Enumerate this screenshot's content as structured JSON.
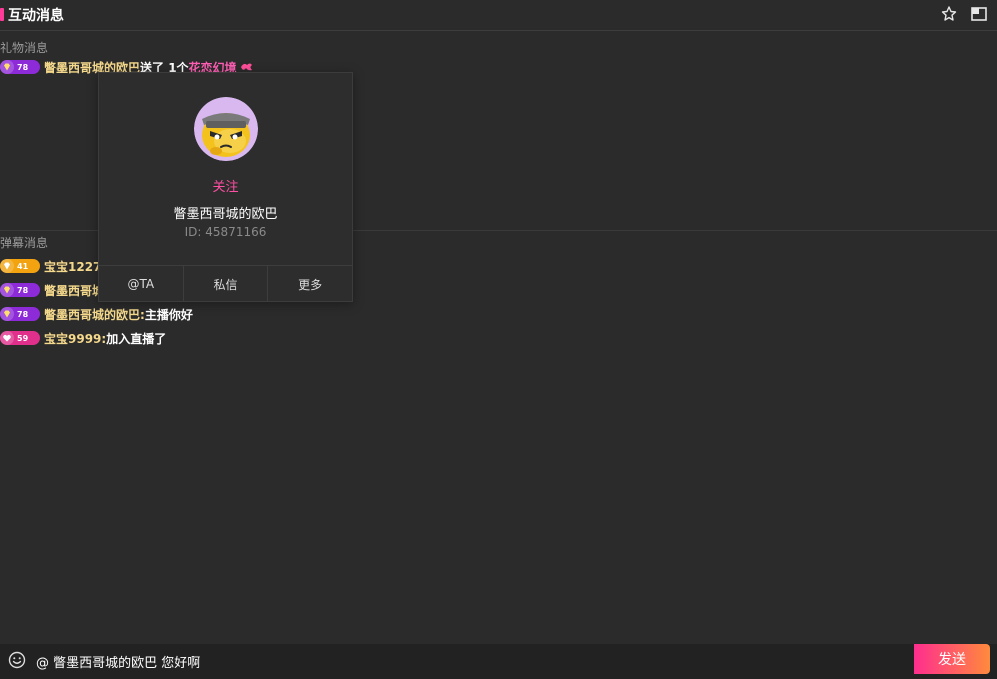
{
  "header": {
    "title": "互动消息",
    "accent_color": "#ff3b9a",
    "icons": [
      "pin-icon",
      "window-icon"
    ]
  },
  "gift_section": {
    "label": "礼物消息",
    "messages": [
      {
        "level": "78",
        "badge_color": "#8e2bd9",
        "user": "瞥墨西哥城的欧巴",
        "action": " 送了 1个",
        "gift": "花恋幻境"
      }
    ]
  },
  "danmu_section": {
    "label": "弹幕消息",
    "messages": [
      {
        "level": "41",
        "badge_color": "#f2a30f",
        "user": "宝宝1227",
        "text": ""
      },
      {
        "level": "78",
        "badge_color": "#8e2bd9",
        "user": "瞥墨西哥城",
        "text": ""
      },
      {
        "level": "78",
        "badge_color": "#8e2bd9",
        "user": "瞥墨西哥城的欧巴:",
        "text": " 主播你好"
      },
      {
        "level": "59",
        "badge_color": "#e0308c",
        "user": "宝宝9999:",
        "text": " 加入直播了"
      }
    ]
  },
  "profile_popup": {
    "follow_label": "关注",
    "name": "瞥墨西哥城的欧巴",
    "id_text": "ID: 45871166",
    "actions": [
      "@TA",
      "私信",
      "更多"
    ]
  },
  "input_bar": {
    "value": "@ 瞥墨西哥城的欧巴 您好啊",
    "send_label": "发送"
  }
}
